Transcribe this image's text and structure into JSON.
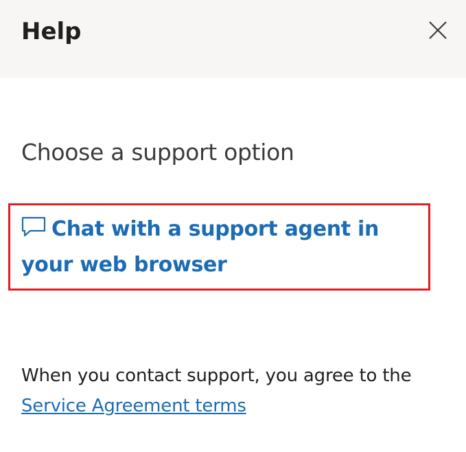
{
  "header": {
    "title": "Help",
    "close_icon": "close-icon"
  },
  "main": {
    "subheading": "Choose a support option",
    "chat_option": {
      "icon": "chat-bubble-icon",
      "label": "Chat with a support agent in your web browser"
    },
    "footer": {
      "text": "When you contact support, you agree to the",
      "link_label": "Service Agreement terms"
    }
  },
  "colors": {
    "header_bg": "#f7f6f4",
    "link": "#1b6cb5",
    "highlight_border": "#e31b23",
    "text": "#1f1f1f"
  }
}
